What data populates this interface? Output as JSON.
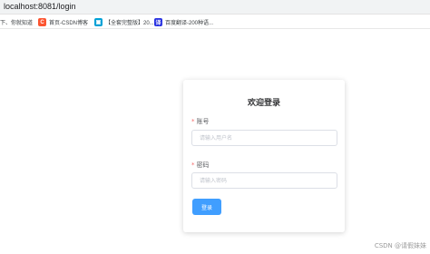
{
  "browser": {
    "url": "localhost:8081/login",
    "bookmarks": [
      {
        "label": "下、你就知道",
        "icon": ""
      },
      {
        "label": "首页-CSDN博客",
        "icon": "csdn-icon",
        "icon_text": "C",
        "color": "#fc5531"
      },
      {
        "label": "【全套完整版】20...",
        "icon": "bilibili-icon",
        "icon_text": "▣",
        "color": "#00a1d6"
      },
      {
        "label": "百度翻译-200种语...",
        "icon": "baidu-translate-icon",
        "icon_text": "译",
        "color": "#2932e1"
      }
    ]
  },
  "login": {
    "title": "欢迎登录",
    "username_label": "账号",
    "username_placeholder": "请输入用户名",
    "password_label": "密码",
    "password_placeholder": "请输入密码",
    "submit_label": "登录",
    "required_marker": "*"
  },
  "watermark": "CSDN @请假妹妹",
  "colors": {
    "primary": "#409eff",
    "required": "#f56c6c"
  }
}
